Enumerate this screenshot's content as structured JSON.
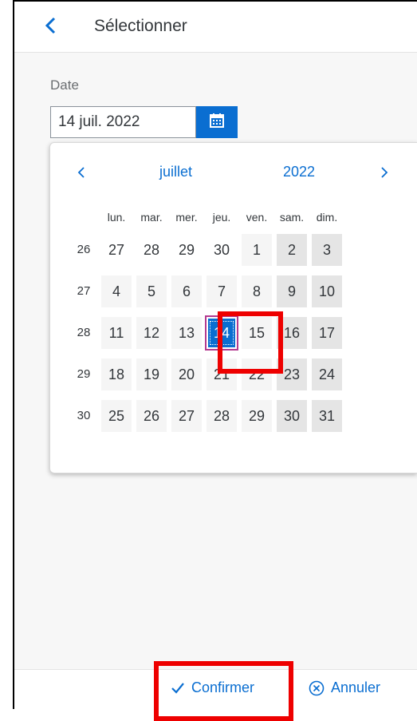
{
  "header": {
    "title": "Sélectionner",
    "back_icon": "chevron-left-icon"
  },
  "field": {
    "label": "Date",
    "value": "14 juil. 2022",
    "calendar_icon": "calendar-icon"
  },
  "calendar": {
    "month": "juillet",
    "year": "2022",
    "weekdays": [
      "lun.",
      "mar.",
      "mer.",
      "jeu.",
      "ven.",
      "sam.",
      "dim."
    ],
    "weeks": [
      {
        "number": "26",
        "days": [
          "27",
          "28",
          "29",
          "30",
          "1",
          "2",
          "3"
        ]
      },
      {
        "number": "27",
        "days": [
          "4",
          "5",
          "6",
          "7",
          "8",
          "9",
          "10"
        ]
      },
      {
        "number": "28",
        "days": [
          "11",
          "12",
          "13",
          "14",
          "15",
          "16",
          "17"
        ]
      },
      {
        "number": "29",
        "days": [
          "18",
          "19",
          "20",
          "21",
          "22",
          "23",
          "24"
        ]
      },
      {
        "number": "30",
        "days": [
          "25",
          "26",
          "27",
          "28",
          "29",
          "30",
          "31"
        ]
      }
    ],
    "selected_day": "14"
  },
  "footer": {
    "confirm_label": "Confirmer",
    "cancel_label": "Annuler"
  },
  "colors": {
    "accent": "#0a6ed1",
    "highlight": "#ee0000",
    "selected_outline": "#b33a8f"
  }
}
